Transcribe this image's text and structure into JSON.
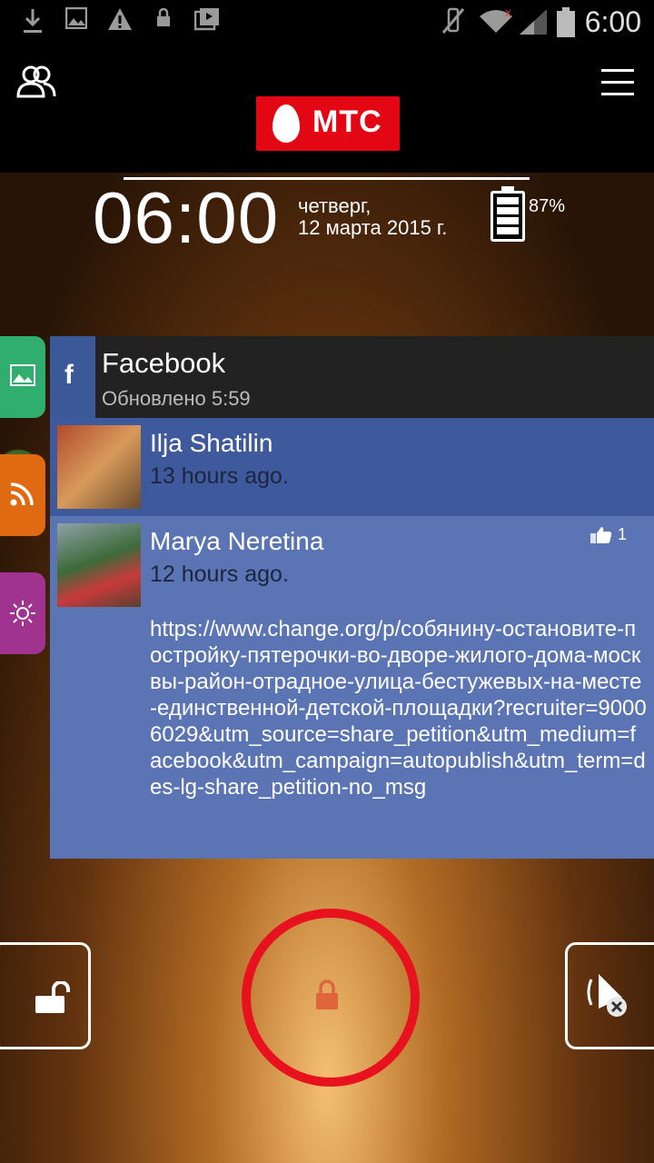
{
  "status_bar": {
    "icons": [
      "download-icon",
      "image-icon",
      "warning-icon",
      "lock-icon",
      "media-icon",
      "mute-icon",
      "wifi-icon",
      "signal-icon",
      "battery-icon"
    ],
    "time": "6:00"
  },
  "header": {
    "logo_text": "МТС",
    "people_icon": "people-icon",
    "menu_icon": "menu-icon"
  },
  "lockscreen": {
    "time": "06:00",
    "day": "четверг,",
    "date": "12 марта 2015 г.",
    "battery_percent": "87%",
    "battery_level": 0.87
  },
  "side_tabs": [
    {
      "icon": "gallery-icon",
      "color": "#2fae6e"
    },
    {
      "icon": "rss-icon",
      "color": "#e06a12"
    },
    {
      "icon": "brightness-icon",
      "color": "#a0338f"
    }
  ],
  "facebook_card": {
    "badge": "f",
    "title": "Facebook",
    "updated": "Обновлено 5:59",
    "posts": [
      {
        "name": "Ilja Shatilin",
        "time": "13 hours ago."
      },
      {
        "name": "Marya Neretina",
        "time": "12 hours ago.",
        "likes": "1",
        "text": "https://www.change.org/p/собянину-остановите-постройку-пятерочки-во-дворе-жилого-дома-москвы-район-отрадное-улица-бестужевых-на-месте-единственной-детской-площадки?recruiter=90006029&utm_source=share_petition&utm_medium=facebook&utm_campaign=autopublish&utm_term=des-lg-share_petition-no_msg"
      }
    ]
  },
  "controls": {
    "unlock_icon": "unlock-icon",
    "center_icon": "lock-icon",
    "mute_icon": "mute-vibrate-icon",
    "accent": "#e8121e"
  }
}
